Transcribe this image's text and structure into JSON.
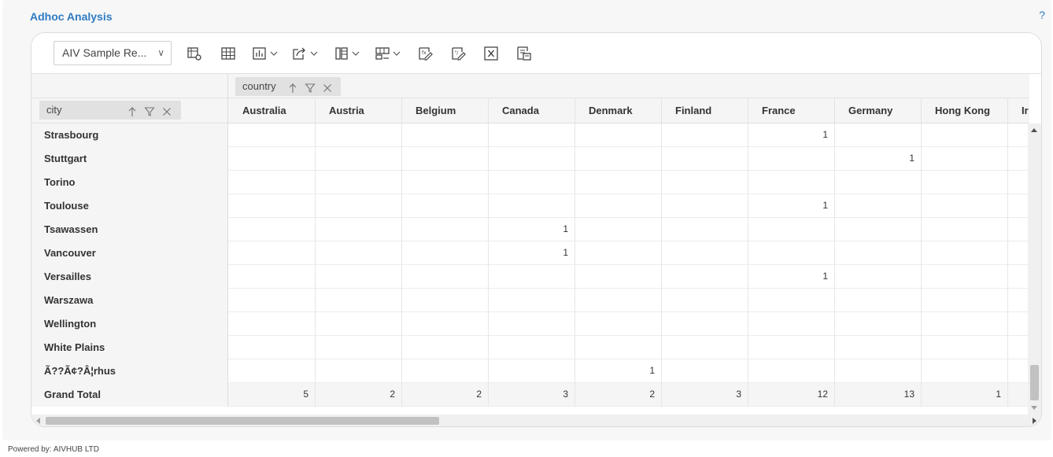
{
  "header": {
    "title": "Adhoc Analysis",
    "help": "?"
  },
  "toolbar": {
    "report_select": "AIV Sample Re...",
    "buttons": [
      {
        "name": "pivot-settings-icon"
      },
      {
        "name": "table-view-icon"
      },
      {
        "name": "chart-icon",
        "dropdown": true
      },
      {
        "name": "export-icon",
        "dropdown": true
      },
      {
        "name": "column-layout-icon",
        "dropdown": true
      },
      {
        "name": "row-layout-icon",
        "dropdown": true
      },
      {
        "name": "edit-field-icon"
      },
      {
        "name": "edit-format-icon"
      },
      {
        "name": "excel-icon"
      },
      {
        "name": "save-icon"
      }
    ]
  },
  "pivot": {
    "column_field": "country",
    "row_field": "city",
    "columns": [
      "Australia",
      "Austria",
      "Belgium",
      "Canada",
      "Denmark",
      "Finland",
      "France",
      "Germany",
      "Hong Kong",
      "Ir"
    ],
    "rows": [
      {
        "city": "Strasbourg",
        "values": [
          "",
          "",
          "",
          "",
          "",
          "",
          "1",
          "",
          "",
          ""
        ]
      },
      {
        "city": "Stuttgart",
        "values": [
          "",
          "",
          "",
          "",
          "",
          "",
          "",
          "1",
          "",
          ""
        ]
      },
      {
        "city": "Torino",
        "values": [
          "",
          "",
          "",
          "",
          "",
          "",
          "",
          "",
          "",
          ""
        ]
      },
      {
        "city": "Toulouse",
        "values": [
          "",
          "",
          "",
          "",
          "",
          "",
          "1",
          "",
          "",
          ""
        ]
      },
      {
        "city": "Tsawassen",
        "values": [
          "",
          "",
          "",
          "1",
          "",
          "",
          "",
          "",
          "",
          ""
        ]
      },
      {
        "city": "Vancouver",
        "values": [
          "",
          "",
          "",
          "1",
          "",
          "",
          "",
          "",
          "",
          ""
        ]
      },
      {
        "city": "Versailles",
        "values": [
          "",
          "",
          "",
          "",
          "",
          "",
          "1",
          "",
          "",
          ""
        ]
      },
      {
        "city": "Warszawa",
        "values": [
          "",
          "",
          "",
          "",
          "",
          "",
          "",
          "",
          "",
          ""
        ]
      },
      {
        "city": "Wellington",
        "values": [
          "",
          "",
          "",
          "",
          "",
          "",
          "",
          "",
          "",
          ""
        ]
      },
      {
        "city": "White Plains",
        "values": [
          "",
          "",
          "",
          "",
          "",
          "",
          "",
          "",
          "",
          ""
        ]
      },
      {
        "city": "Ã??Ã¢?Â¦rhus",
        "values": [
          "",
          "",
          "",
          "",
          "1",
          "",
          "",
          "",
          "",
          ""
        ]
      }
    ],
    "grand_total": {
      "label": "Grand Total",
      "values": [
        "5",
        "2",
        "2",
        "3",
        "2",
        "3",
        "12",
        "13",
        "1",
        ""
      ]
    }
  },
  "footer": {
    "text": "Powered by: AIVHUB LTD"
  }
}
